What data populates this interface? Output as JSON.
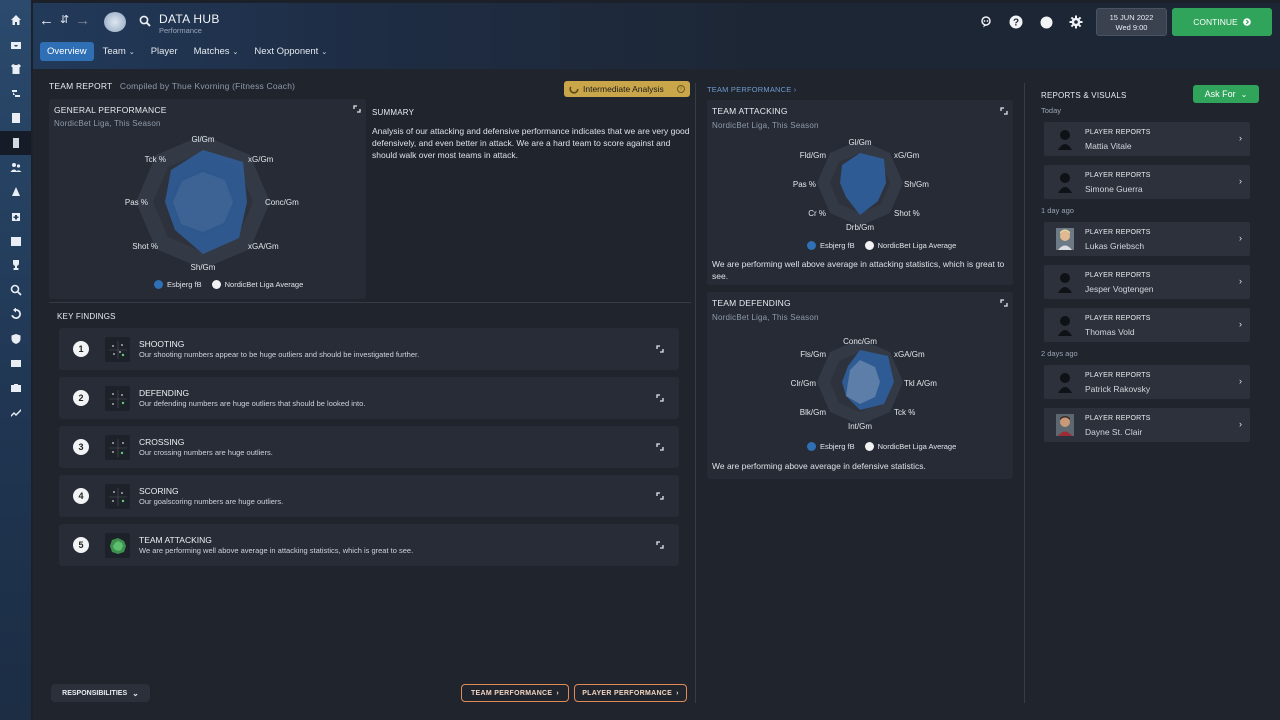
{
  "header": {
    "title": "DATA HUB",
    "subtitle": "Performance",
    "date_line1": "15 JUN 2022",
    "date_line2": "Wed 9:00",
    "continue_label": "CONTINUE"
  },
  "tabs": [
    {
      "label": "Overview",
      "dropdown": false
    },
    {
      "label": "Team",
      "dropdown": true
    },
    {
      "label": "Player",
      "dropdown": false
    },
    {
      "label": "Matches",
      "dropdown": true
    },
    {
      "label": "Next Opponent",
      "dropdown": true
    }
  ],
  "team_report": {
    "heading": "TEAM REPORT",
    "compiled_by": "Compiled by Thue Kvorning (Fitness Coach)",
    "analysis_badge": "Intermediate Analysis",
    "general": {
      "title": "GENERAL PERFORMANCE",
      "context": "NordicBet Liga, This Season",
      "axes": [
        "Gl/Gm",
        "xG/Gm",
        "Conc/Gm",
        "xGA/Gm",
        "Sh/Gm",
        "Shot %",
        "Pas %",
        "Tck %"
      ]
    },
    "summary_title": "SUMMARY",
    "summary_text": "Analysis of our attacking and defensive performance indicates that we are very good defensively, and even better in attack. We are a hard team to score against and should walk over most teams in attack.",
    "legend_team": "Esbjerg fB",
    "legend_avg": "NordicBet Liga Average",
    "colors": {
      "team": "#2f6fb6",
      "avg": "#f2f2f2"
    }
  },
  "key_findings": {
    "heading": "KEY FINDINGS",
    "items": [
      {
        "num": "1",
        "title": "SHOOTING",
        "desc": "Our shooting numbers appear to be huge outliers and should be investigated further."
      },
      {
        "num": "2",
        "title": "DEFENDING",
        "desc": "Our defending numbers are huge outliers that should be looked into."
      },
      {
        "num": "3",
        "title": "CROSSING",
        "desc": "Our crossing numbers are huge outliers."
      },
      {
        "num": "4",
        "title": "SCORING",
        "desc": "Our goalscoring numbers are huge outliers."
      },
      {
        "num": "5",
        "title": "TEAM ATTACKING",
        "desc": "We are performing well above average in attacking statistics, which is great to see."
      }
    ]
  },
  "team_performance": {
    "link": "TEAM PERFORMANCE",
    "attacking": {
      "title": "TEAM ATTACKING",
      "context": "NordicBet Liga, This Season",
      "axes": [
        "Gl/Gm",
        "xG/Gm",
        "Sh/Gm",
        "Shot %",
        "Drb/Gm",
        "Cr %",
        "Pas %",
        "Fld/Gm"
      ],
      "note": "We are performing well above average in attacking statistics, which is great to see."
    },
    "defending": {
      "title": "TEAM DEFENDING",
      "context": "NordicBet Liga, This Season",
      "axes": [
        "Conc/Gm",
        "xGA/Gm",
        "Tkl A/Gm",
        "Tck %",
        "Int/Gm",
        "Blk/Gm",
        "Clr/Gm",
        "Fls/Gm"
      ],
      "note": "We are performing above average in defensive statistics."
    }
  },
  "reports": {
    "heading": "REPORTS & VISUALS",
    "ask_for": "Ask For",
    "groups": [
      {
        "label": "Today",
        "items": [
          {
            "type": "PLAYER REPORTS",
            "name": "Mattia Vitale",
            "photo": false
          },
          {
            "type": "PLAYER REPORTS",
            "name": "Simone Guerra",
            "photo": false
          }
        ]
      },
      {
        "label": "1 day ago",
        "items": [
          {
            "type": "PLAYER REPORTS",
            "name": "Lukas Griebsch",
            "photo": true
          },
          {
            "type": "PLAYER REPORTS",
            "name": "Jesper Vogtengen",
            "photo": false
          },
          {
            "type": "PLAYER REPORTS",
            "name": "Thomas Vold",
            "photo": false
          }
        ]
      },
      {
        "label": "2 days ago",
        "items": [
          {
            "type": "PLAYER REPORTS",
            "name": "Patrick Rakovsky",
            "photo": false
          },
          {
            "type": "PLAYER REPORTS",
            "name": "Dayne St. Clair",
            "photo": true
          }
        ]
      }
    ]
  },
  "footer": {
    "responsibilities": "RESPONSIBILITIES",
    "team_performance_btn": "TEAM PERFORMANCE",
    "player_performance_btn": "PLAYER PERFORMANCE"
  }
}
